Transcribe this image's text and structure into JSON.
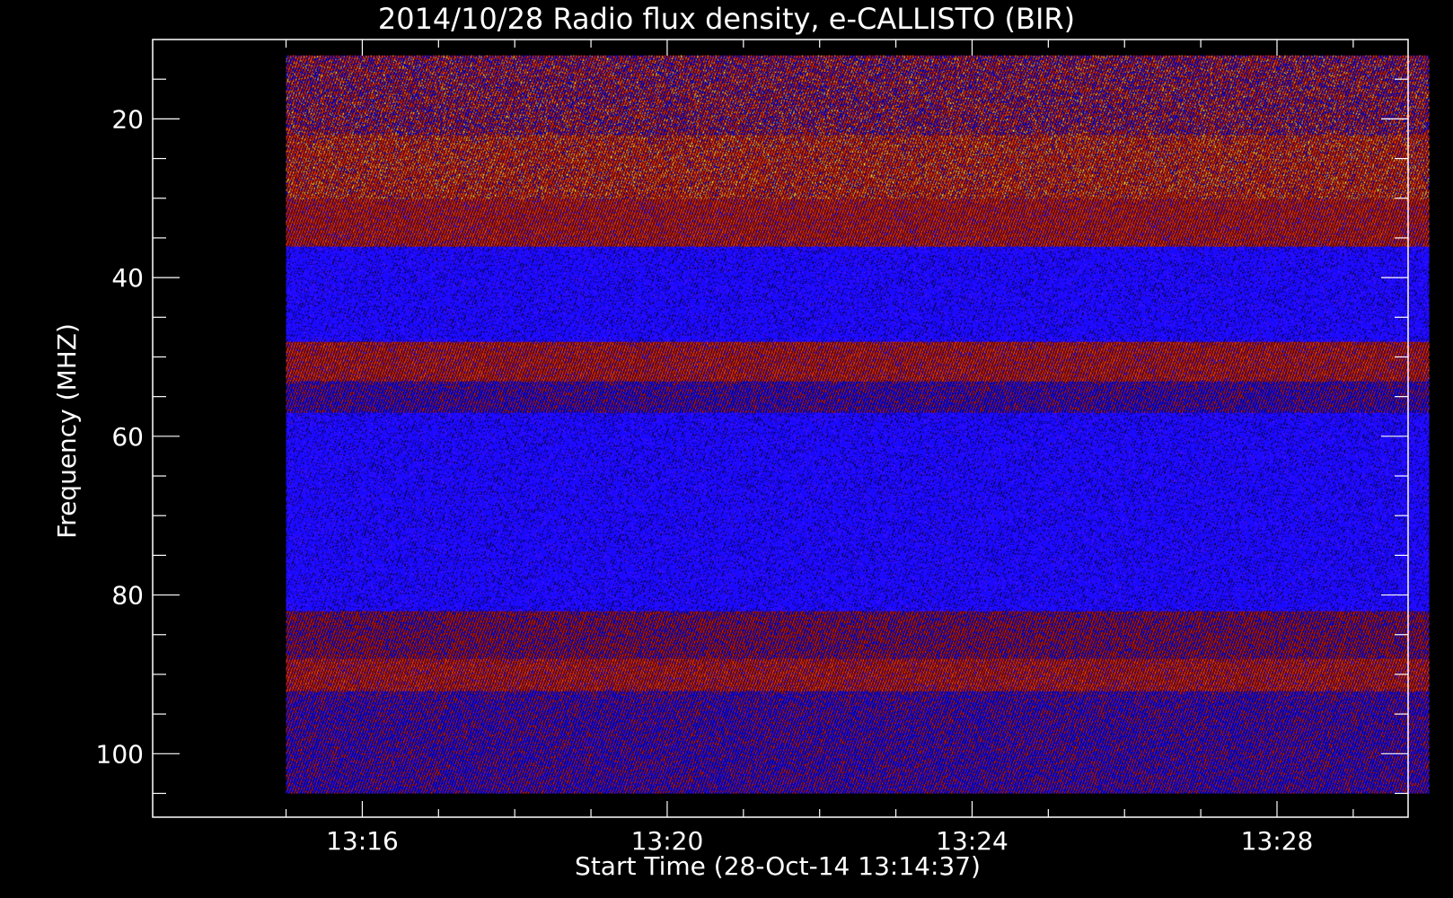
{
  "chart_data": {
    "type": "heatmap",
    "title": "2014/10/28  Radio flux density, e-CALLISTO (BIR)",
    "xlabel": "Start Time (28-Oct-14 13:14:37)",
    "ylabel": "Frequency (MHZ)",
    "x_ticks": [
      "13:16",
      "13:20",
      "13:24",
      "13:28"
    ],
    "y_ticks": [
      "20",
      "40",
      "60",
      "80",
      "100"
    ],
    "x_range_minutes": [
      13.25,
      29.72
    ],
    "y_range_mhz": [
      10,
      108
    ],
    "data_extent_minutes": [
      15.0,
      30.0
    ],
    "data_extent_mhz": [
      12,
      105
    ],
    "y_inverted": true,
    "colormap": [
      "#000000",
      "#1a0aff",
      "#5010ff",
      "#c01818",
      "#ff3a10",
      "#ffd040"
    ],
    "bands": [
      {
        "from_mhz": 12,
        "to_mhz": 22,
        "level": "mixed-red-blue"
      },
      {
        "from_mhz": 22,
        "to_mhz": 30,
        "level": "red-yellow"
      },
      {
        "from_mhz": 30,
        "to_mhz": 36,
        "level": "red"
      },
      {
        "from_mhz": 36,
        "to_mhz": 48,
        "level": "blue"
      },
      {
        "from_mhz": 48,
        "to_mhz": 53,
        "level": "red"
      },
      {
        "from_mhz": 53,
        "to_mhz": 57,
        "level": "blue-red"
      },
      {
        "from_mhz": 57,
        "to_mhz": 82,
        "level": "blue"
      },
      {
        "from_mhz": 82,
        "to_mhz": 88,
        "level": "dark-red"
      },
      {
        "from_mhz": 88,
        "to_mhz": 92,
        "level": "red"
      },
      {
        "from_mhz": 92,
        "to_mhz": 105,
        "level": "blue-red"
      }
    ],
    "grid": false
  }
}
